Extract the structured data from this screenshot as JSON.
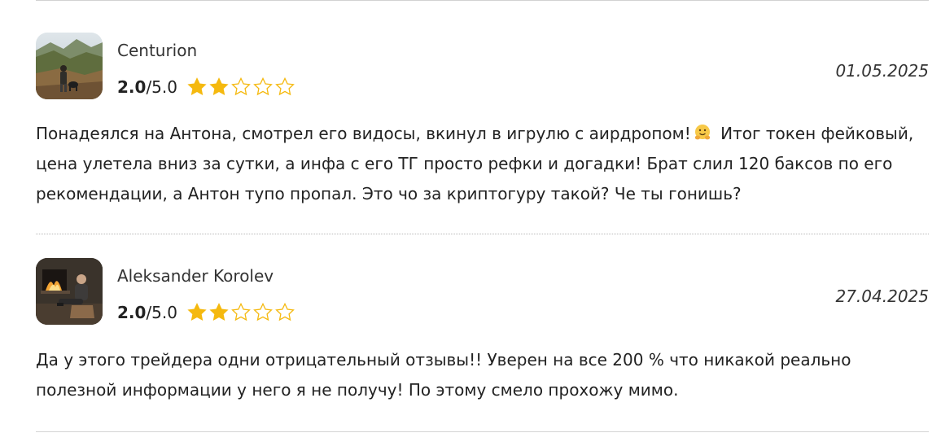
{
  "reviews": [
    {
      "author": "Centurion",
      "score": "2.0",
      "scale": "/5.0",
      "stars_filled": 2,
      "stars_total": 5,
      "date": "01.05.2025",
      "text_part1": "Понадеялся на Антона, смотрел его видосы, вкинул в игрулю с аирдропом!",
      "emoji_icon": "hugging-face-emoji",
      "text_part2": "Итог токен фейковый, цена улетела вниз за сутки, а инфа с его ТГ просто рефки и догадки! Брат слил 120 баксов по его рекомендации, а Антон тупо пропал. Это чо за криптогуру такой? Че ты гонишь?",
      "avatar_icon": "person-with-dog-mountains-photo"
    },
    {
      "author": "Aleksander Korolev",
      "score": "2.0",
      "scale": "/5.0",
      "stars_filled": 2,
      "stars_total": 5,
      "date": "27.04.2025",
      "text_part1": "Да у этого трейдера одни отрицательный отзывы!! Уверен на все 200 % что никакой реально полезной информации у него я не получу! По этому смело прохожу мимо.",
      "avatar_icon": "man-by-fireplace-photo"
    }
  ],
  "colors": {
    "star_fill": "#f5b90f",
    "star_outline": "#f5b90f",
    "divider": "#d2d2d2"
  }
}
